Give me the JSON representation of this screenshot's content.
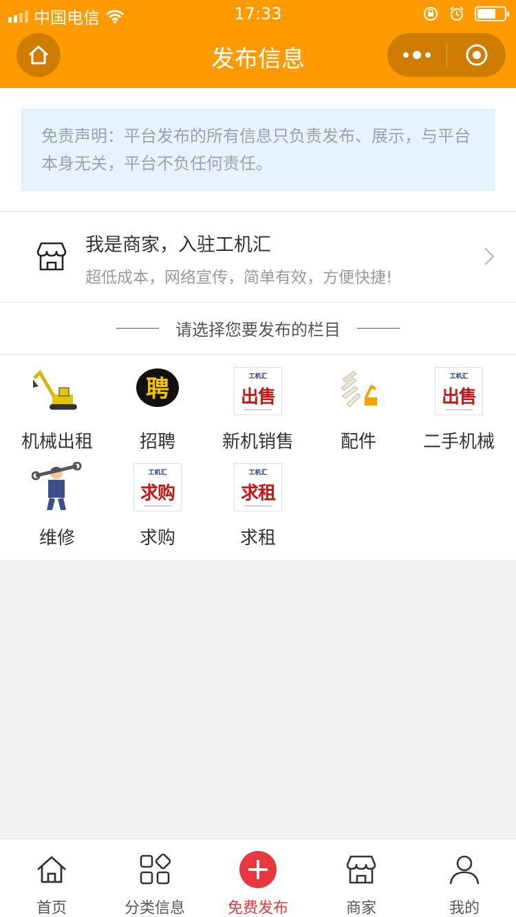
{
  "status_bar": {
    "carrier": "中国电信",
    "time": "17:33"
  },
  "nav": {
    "title": "发布信息"
  },
  "notice": {
    "text": "免责声明：平台发布的所有信息只负责发布、展示，与平台本身无关，平台不负任何责任。"
  },
  "merchant": {
    "title": "我是商家，入驻工机汇",
    "subtitle": "超低成本，网络宣传，简单有效，方便快捷!"
  },
  "section": {
    "title": "请选择您要发布的栏目"
  },
  "categories": [
    {
      "label": "机械出租",
      "icon": "excavator-icon"
    },
    {
      "label": "招聘",
      "icon": "recruit-icon",
      "tile_text": "聘"
    },
    {
      "label": "新机销售",
      "icon": "sale-tile-icon",
      "tile_brand": "工机汇",
      "tile_text": "出售"
    },
    {
      "label": "配件",
      "icon": "parts-icon"
    },
    {
      "label": "二手机械",
      "icon": "sale-tile-icon",
      "tile_brand": "工机汇",
      "tile_text": "出售"
    },
    {
      "label": "维修",
      "icon": "mechanic-icon"
    },
    {
      "label": "求购",
      "icon": "buy-tile-icon",
      "tile_brand": "工机汇",
      "tile_text": "求购"
    },
    {
      "label": "求租",
      "icon": "rent-tile-icon",
      "tile_brand": "工机汇",
      "tile_text": "求租"
    }
  ],
  "tabbar": {
    "items": [
      {
        "label": "首页",
        "icon": "home-icon"
      },
      {
        "label": "分类信息",
        "icon": "grid-icon"
      },
      {
        "label": "免费发布",
        "icon": "plus-icon",
        "active": true
      },
      {
        "label": "商家",
        "icon": "shop-icon"
      },
      {
        "label": "我的",
        "icon": "user-icon"
      }
    ]
  },
  "colors": {
    "nav_bg": "#ff9a00",
    "accent": "#e8373e",
    "notice_bg": "#e6f3fc"
  }
}
